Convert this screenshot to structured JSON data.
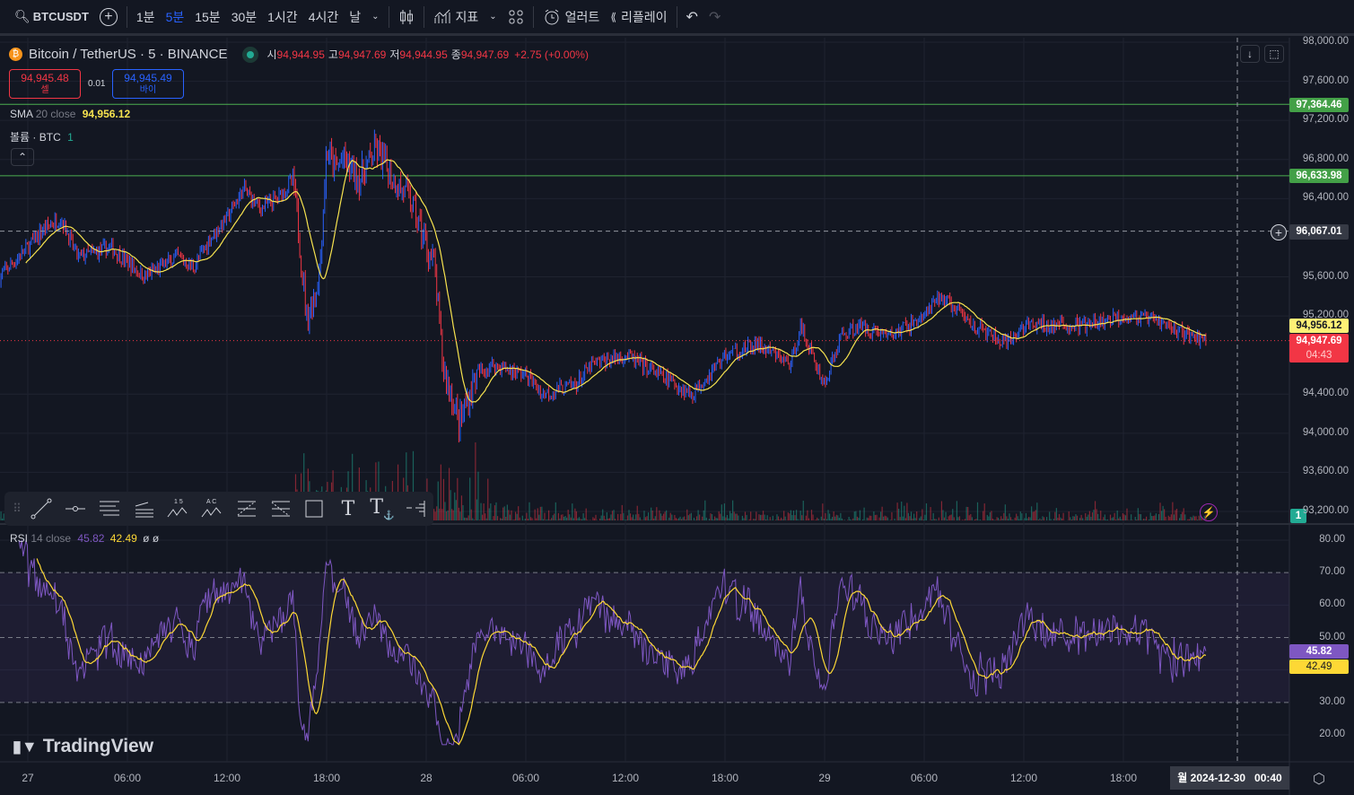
{
  "toolbar": {
    "symbol": "BTCUSDT",
    "intervals": [
      "1분",
      "5분",
      "15분",
      "30분",
      "1시간",
      "4시간",
      "날"
    ],
    "active_interval": "5분",
    "indicators": "지표",
    "alert": "얼러트",
    "replay": "리플레이"
  },
  "legend": {
    "title": "Bitcoin / TetherUS · 5 · BINANCE",
    "o_label": "시",
    "o": "94,944.95",
    "h_label": "고",
    "h": "94,947.69",
    "l_label": "저",
    "l": "94,944.95",
    "c_label": "종",
    "c": "94,947.69",
    "change": "+2.75 (+0.00%)",
    "sell_price": "94,945.48",
    "sell_label": "셀",
    "spread": "0.01",
    "buy_price": "94,945.49",
    "buy_label": "바이",
    "sma_name": "SMA",
    "sma_params": "20 close",
    "sma_value": "94,956.12",
    "vol_name": "볼륨 · BTC",
    "vol_value": "1",
    "rsi_name": "RSI",
    "rsi_params": "14 close",
    "rsi_value": "45.82",
    "rsi_ma_value": "42.49",
    "rsi_extra1": "ø",
    "rsi_extra2": "ø"
  },
  "price_axis": {
    "ticks": [
      "98,000.00",
      "97,600.00",
      "97,200.00",
      "96,800.00",
      "96,400.00",
      "95,600.00",
      "95,200.00",
      "94,400.00",
      "94,000.00",
      "93,600.00",
      "93,200.00"
    ],
    "tick_values": [
      98000,
      97600,
      97200,
      96800,
      96400,
      95600,
      95200,
      94400,
      94000,
      93600,
      93200
    ],
    "line1": "97,364.46",
    "line1_value": 97364.46,
    "line2": "96,633.98",
    "line2_value": 96633.98,
    "crosshair": "96,067.01",
    "crosshair_value": 96067.01,
    "sma_tag": "94,956.12",
    "last_tag": "94,947.69",
    "countdown": "04:43",
    "vol_tag": "1"
  },
  "rsi_axis": {
    "ticks": [
      "80.00",
      "70.00",
      "60.00",
      "50.00",
      "30.00",
      "20.00"
    ],
    "tick_values": [
      80,
      70,
      60,
      50,
      30,
      20
    ],
    "rsi_tag": "45.82",
    "ma_tag": "42.49"
  },
  "time_axis": {
    "labels": [
      "27",
      "06:00",
      "12:00",
      "18:00",
      "28",
      "06:00",
      "12:00",
      "18:00",
      "29",
      "06:00",
      "12:00",
      "18:00"
    ],
    "label_hours": [
      0,
      6,
      12,
      18,
      24,
      30,
      36,
      42,
      48,
      54,
      60,
      66
    ],
    "crosshair": "월 2024-12-30   00:40"
  },
  "brand": "TradingView",
  "colors": {
    "up": "#2962ff",
    "down": "#f23645",
    "sma": "#f7e34f",
    "rsi": "#7e57c2",
    "rsi_ma": "#fdd835",
    "hline": "#4caf50"
  },
  "chart_data": {
    "type": "candlestick",
    "symbol": "BTCUSDT",
    "interval": "5m",
    "ylim": [
      93200,
      98000
    ],
    "path_hours": [
      -1.7,
      0,
      1,
      2,
      3,
      5,
      7,
      9,
      10,
      11,
      12,
      13,
      14,
      15,
      16,
      16.8,
      17.3,
      17.6,
      18,
      18.5,
      19,
      20,
      21,
      22,
      23,
      24.5,
      25,
      26,
      27,
      28,
      30,
      31,
      33,
      34,
      36,
      38,
      40,
      41,
      42,
      44,
      46,
      46.5,
      47,
      48,
      49,
      50,
      52,
      54,
      55,
      57,
      59,
      60,
      62,
      64,
      66,
      68,
      70,
      71
    ],
    "path_prices": [
      95600,
      95900,
      96100,
      96200,
      95800,
      95900,
      95600,
      95800,
      95700,
      96000,
      96200,
      96500,
      96300,
      96400,
      96600,
      95200,
      95400,
      95700,
      96900,
      96700,
      96800,
      96600,
      96900,
      96600,
      96400,
      95700,
      94700,
      94100,
      94600,
      94700,
      94600,
      94400,
      94500,
      94700,
      94800,
      94600,
      94400,
      94600,
      94800,
      94900,
      94700,
      95100,
      94900,
      94500,
      95000,
      95100,
      95000,
      95200,
      95400,
      95100,
      94900,
      95100,
      95100,
      95100,
      95200,
      95150,
      95000,
      94948
    ],
    "rsi_ylim": [
      15,
      82
    ],
    "sma_period": 20,
    "rsi_period": 14
  }
}
